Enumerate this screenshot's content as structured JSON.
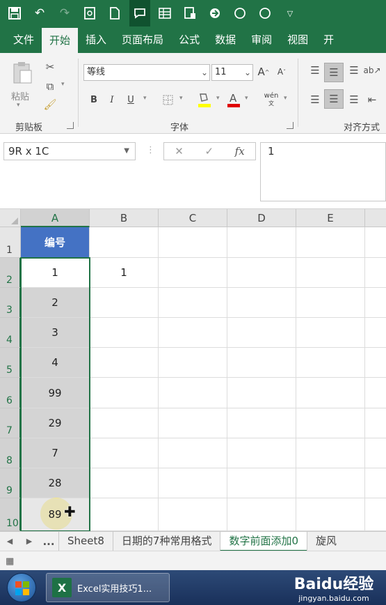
{
  "quick_access": {
    "icons": [
      "save-icon",
      "undo-icon",
      "redo-icon",
      "print-preview-icon",
      "new-file-icon",
      "comment-icon",
      "table-icon",
      "device-icon",
      "share-icon",
      "circle-icon",
      "circle-icon",
      "customize-icon"
    ]
  },
  "ribbon_tabs": [
    "文件",
    "开始",
    "插入",
    "页面布局",
    "公式",
    "数据",
    "审阅",
    "视图",
    "开"
  ],
  "ribbon": {
    "clipboard": {
      "paste": "粘贴",
      "label": "剪贴板"
    },
    "font": {
      "name": "等线",
      "size": "11",
      "bold": "B",
      "italic": "I",
      "underline": "U",
      "grow": "A",
      "shrink": "A",
      "wen": "wén",
      "label": "字体"
    },
    "align": {
      "label": "对齐方式"
    }
  },
  "formula_bar": {
    "name_box": "9R x 1C",
    "cancel": "✕",
    "confirm": "✓",
    "fx": "fx",
    "value": "1"
  },
  "grid": {
    "columns": [
      "A",
      "B",
      "C",
      "D",
      "E"
    ],
    "rows": [
      "1",
      "2",
      "3",
      "4",
      "5",
      "6",
      "7",
      "8",
      "9",
      "10"
    ],
    "a1_header": "编号",
    "column_a": [
      "1",
      "2",
      "3",
      "4",
      "99",
      "29",
      "7",
      "28",
      "89"
    ],
    "b2": "1"
  },
  "sheet_tabs": {
    "nav_prev": "◀",
    "nav_next": "▶",
    "more": "...",
    "tabs": [
      "Sheet8",
      "日期的7种常用格式",
      "数字前面添加0",
      "旋风"
    ]
  },
  "taskbar": {
    "app_label": "Excel实用技巧1...",
    "app_icon": "X",
    "watermark_brand": "Baidu经验",
    "watermark_url": "jingyan.baidu.com"
  },
  "colors": {
    "excel_green": "#217346",
    "header_blue": "#4472c4",
    "selection_gray": "#d4d4d4"
  }
}
